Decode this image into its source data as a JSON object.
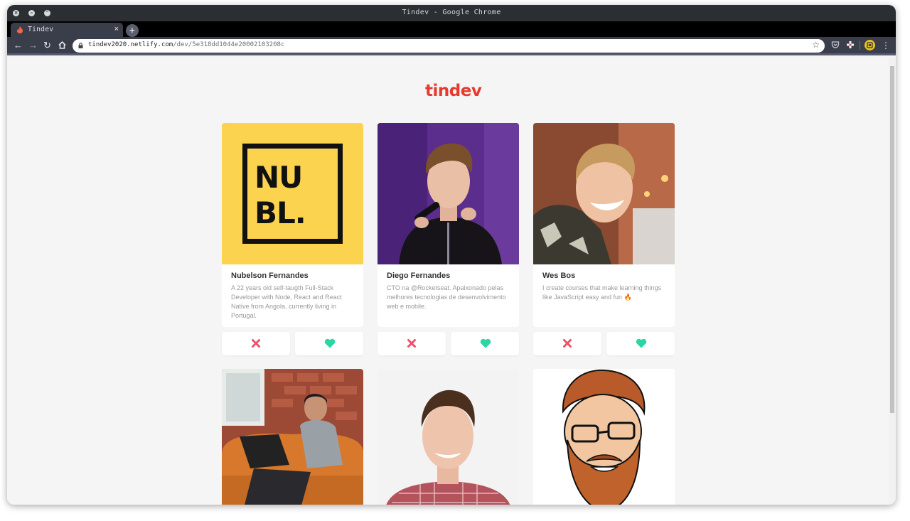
{
  "window": {
    "title": "Tindev - Google Chrome"
  },
  "tab": {
    "title": "Tindev",
    "close": "×",
    "new_tab": "+"
  },
  "address": {
    "host": "tindev2020.netlify.com",
    "path": "/dev/5e318dd1044e20002103208c"
  },
  "logo": "tindev",
  "cards": [
    {
      "name": "Nubelson Fernandes",
      "bio": "A 22 years old self-taugth Full-Stack Developer with Node, React and React Native from Angola, currently living in Portugal.",
      "avatar": "nubl-logo",
      "avatar_text": [
        "NU",
        "BL."
      ]
    },
    {
      "name": "Diego Fernandes",
      "bio": "CTO na @Rocketseat. Apaixonado pelas melhores tecnologias de desenvolvimento web e mobile.",
      "avatar": "man-with-microphone-photo"
    },
    {
      "name": "Wes Bos",
      "bio": "I create courses that make learning things like JavaScript easy and fun 🔥",
      "avatar": "smiling-man-photo"
    },
    {
      "name": "",
      "bio": "",
      "avatar": "man-with-laptop-on-couch-photo"
    },
    {
      "name": "",
      "bio": "",
      "avatar": "man-in-checked-shirt-photo"
    },
    {
      "name": "",
      "bio": "",
      "avatar": "bearded-man-caricature"
    }
  ],
  "actions": {
    "dislike_icon": "x-icon",
    "like_icon": "heart-icon"
  },
  "colors": {
    "brand": "#e63b2e",
    "dislike": "#f0506e",
    "like": "#2ad6a3",
    "nubl_yellow": "#fcd34f",
    "chrome_dark": "#2b2e33"
  }
}
